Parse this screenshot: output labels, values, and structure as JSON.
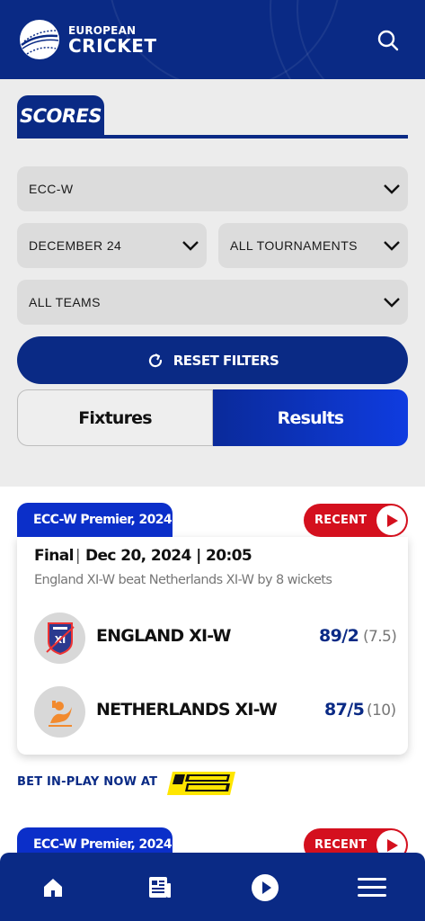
{
  "header": {
    "logo_line1": "EUROPEAN",
    "logo_line2": "CRICKET",
    "brand_color": "#0a2a85"
  },
  "scores_title": "SCORES",
  "filters": {
    "competition": "ECC-W",
    "month": "DECEMBER 24",
    "tournament": "ALL TOURNAMENTS",
    "teams": "ALL TEAMS",
    "reset_label": "RESET FILTERS"
  },
  "toggle": {
    "fixtures_label": "Fixtures",
    "results_label": "Results",
    "active": "Results"
  },
  "matches": [
    {
      "competition": "ECC-W Premier, 2024",
      "badge": "RECENT",
      "status": "Final",
      "date": "Dec 20, 2024 | 20:05",
      "result": "England XI-W beat Netherlands XI-W by 8 wickets",
      "teams": [
        {
          "name": "ENGLAND XI-W",
          "score": "89/2",
          "overs": "(7.5)"
        },
        {
          "name": "NETHERLANDS XI-W",
          "score": "87/5",
          "overs": "(10)"
        }
      ]
    },
    {
      "competition": "ECC-W Premier, 2024",
      "badge": "RECENT"
    }
  ],
  "bet": {
    "text": "BET IN-PLAY NOW AT",
    "sponsor_logo": "PARI MATCH"
  },
  "bottom_nav": [
    "home-icon",
    "news-icon",
    "play-icon",
    "menu-icon"
  ],
  "colors": {
    "accent_red": "#d4101e",
    "accent_blue": "#0b2fc9",
    "sponsor_yellow": "#ffe600"
  }
}
